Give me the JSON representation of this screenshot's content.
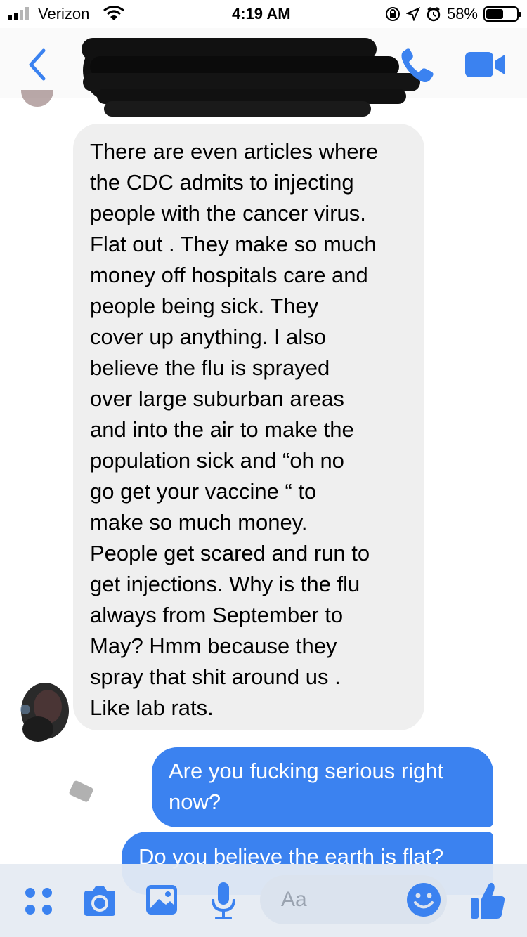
{
  "status_bar": {
    "carrier": "Verizon",
    "time": "4:19 AM",
    "battery_percent": "58%",
    "battery_level": 0.58
  },
  "nav": {
    "contact_name": ""
  },
  "messages": {
    "incoming_1_lines": [
      "There are even articles where",
      "the CDC admits to injecting",
      "people with the cancer virus.",
      "Flat out . They make so much",
      "money off hospitals care and",
      "people being sick. They",
      "cover up anything. I also",
      "believe the flu is sprayed",
      "over large suburban areas",
      "and into the air to make the",
      "population sick and “oh no",
      "go get your vaccine “ to",
      "make so much money.",
      "People get scared and run to",
      "get injections. Why is the flu",
      "always from September to",
      "May? Hmm because they",
      "spray that shit around us .",
      "Like lab rats."
    ],
    "outgoing_1_lines": [
      "Are you fucking serious right",
      "now?"
    ],
    "outgoing_2_lines": [
      "Do you believe the earth is flat?"
    ]
  },
  "composer": {
    "placeholder": "Aa"
  },
  "colors": {
    "accent": "#3b82f0",
    "incoming_bubble": "#efefef",
    "composer_bg": "#e6ebf2"
  },
  "icons": [
    "signal-icon",
    "wifi-icon",
    "lock-rotation-icon",
    "location-icon",
    "alarm-icon",
    "battery-icon",
    "back-icon",
    "phone-icon",
    "video-icon",
    "more-icon",
    "camera-icon",
    "photo-icon",
    "mic-icon",
    "emoji-icon",
    "thumbs-up-icon"
  ]
}
